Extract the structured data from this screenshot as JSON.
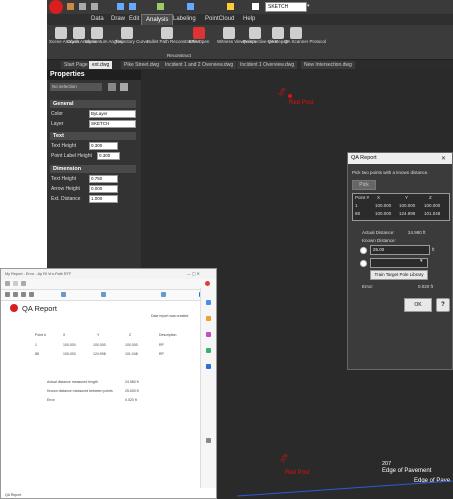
{
  "window": {
    "title_input": "SKETCH"
  },
  "menu": [
    {
      "label": "Data"
    },
    {
      "label": "Draw"
    },
    {
      "label": "Edit"
    },
    {
      "label": "Analysis"
    },
    {
      "label": "Labeling"
    },
    {
      "label": "PointCloud"
    },
    {
      "label": "Help"
    }
  ],
  "ribbon": {
    "items": [
      {
        "label": "Scene Analysis"
      },
      {
        "label": "Crush Analysis"
      },
      {
        "label": "Momentum Angles"
      },
      {
        "label": "Trajectory Curve"
      },
      {
        "label": "Bullet Path Reconstruction"
      },
      {
        "label": "BPA Open"
      },
      {
        "label": "Witness Viewpoints"
      },
      {
        "label": "Perspective View"
      },
      {
        "label": "QA Report"
      },
      {
        "label": "QA Scanner Protocol"
      }
    ],
    "group_label": "Reconstruct"
  },
  "doc_tabs": [
    {
      "label": "Start Page"
    },
    {
      "label": "ext.dwg"
    },
    {
      "label": "Pike Street.dwg"
    },
    {
      "label": "Incident 1 and 2 Overview.dwg"
    },
    {
      "label": "Incident 1 Overview.dwg"
    },
    {
      "label": "New Intersection.dwg"
    }
  ],
  "properties": {
    "title": "Properties",
    "selection": "No selection",
    "general": "General",
    "color_label": "Color",
    "color_value": "ByLayer",
    "layer_label": "Layer",
    "layer_value": "SKETCH",
    "text": "Text",
    "text_height_label": "Text Height",
    "text_height_value": "0.300",
    "point_label_height_label": "Point Label Height",
    "point_label_height_value": "0.300",
    "dimension": "Dimension",
    "dim_text_height_label": "Text Height",
    "dim_text_height_value": "0.750",
    "arrow_height_label": "Arrow Height",
    "arrow_height_value": "0.000",
    "ext_distance_label": "Ext. Distance",
    "ext_distance_value": "1.000"
  },
  "canvas": {
    "top_label_num": "208",
    "top_label_name": "Red Post",
    "bottom_red_num": "208",
    "bottom_red_name": "Red Post",
    "bottom_white_num": "207",
    "bottom_white_name": "Edge of Pavement",
    "bottom_white2_name": "Edge of Pave"
  },
  "qa_dialog": {
    "title": "QA Report",
    "close": "✕",
    "instruction": "Pick two points with a known distance.",
    "pick_button": "Pick",
    "col_point": "Point #",
    "col_x": "X",
    "col_y": "Y",
    "col_z": "Z",
    "row1": {
      "id": "1",
      "x": "100.000",
      "y": "100.000",
      "z": "100.000"
    },
    "row2": {
      "id": "88",
      "x": "100.000",
      "y": "124.998",
      "z": "101.048"
    },
    "actual_distance_label": "Actual Distance:",
    "actual_distance_value": "24.980 ft",
    "known_distance_label": "Known Distance:",
    "known_distance_value": "25.00",
    "unit": "ft",
    "train_button": "Train Target Pole Library",
    "error_label": "Error:",
    "error_value": "0.020 ft",
    "ok_button": "OK",
    "help_icon": "?"
  },
  "browser": {
    "tab_text": "My Report - Error - Ap Rt Vrn-Path RTF",
    "report_title": "QA Report",
    "report_subtitle": "Date report was created",
    "headers": [
      "Point #",
      "X",
      "Y",
      "Z",
      "Description"
    ],
    "rows": [
      [
        "1",
        "100.000",
        "100.000",
        "100.000",
        "RP"
      ],
      [
        "88",
        "100.000",
        "124.998",
        "101.048",
        "RP"
      ]
    ],
    "summary": [
      {
        "label": "Actual distance measured length",
        "value": "24.980 ft"
      },
      {
        "label": "Known distance measured between points",
        "value": "25.000 ft"
      },
      {
        "label": "Error",
        "value": "0.020 ft"
      }
    ],
    "status": "QA Report"
  }
}
